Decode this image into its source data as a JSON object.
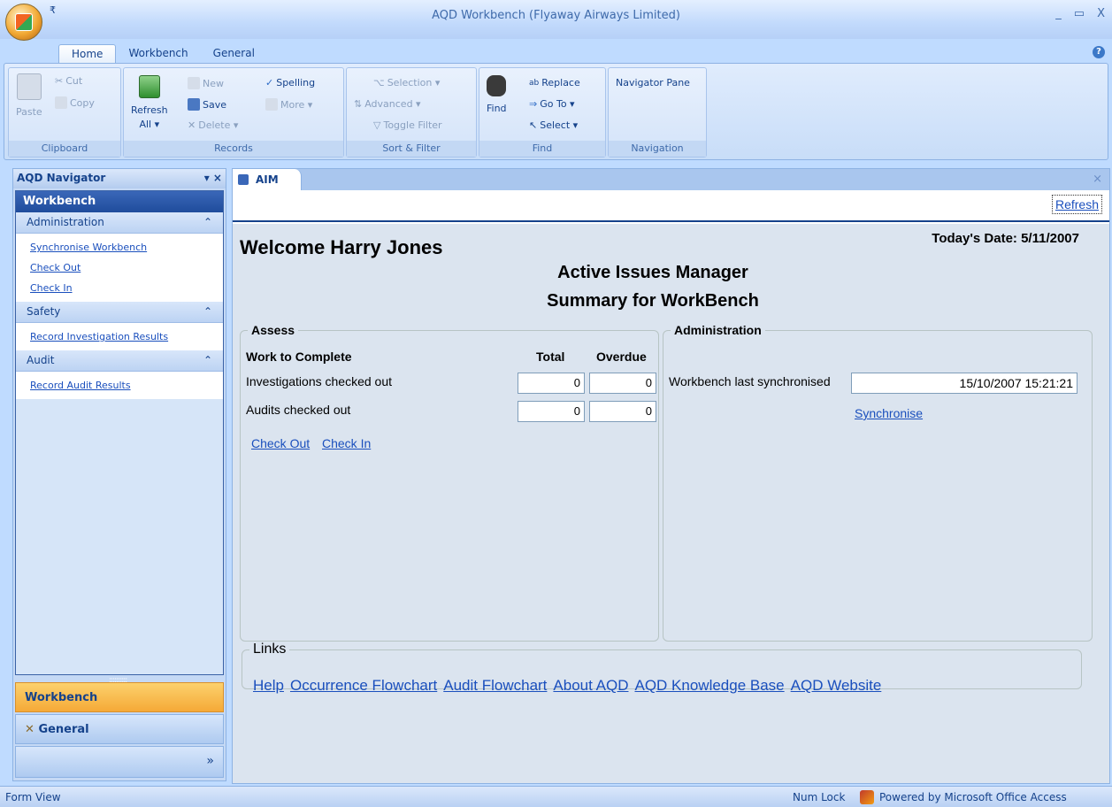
{
  "window": {
    "title": "AQD Workbench (Flyaway Airways Limited)",
    "qat": "₹",
    "minimize": "_",
    "restore": "▭",
    "close": "X"
  },
  "ribbon": {
    "tabs": [
      "Home",
      "Workbench",
      "General"
    ],
    "help": "?",
    "clipboard": {
      "paste": "Paste",
      "cut": "Cut",
      "copy": "Copy",
      "label": "Clipboard"
    },
    "records": {
      "refresh": "Refresh",
      "refresh_sub": "All ▾",
      "new": "New",
      "save": "Save",
      "delete": "Delete ▾",
      "spelling": "Spelling",
      "more": "More ▾",
      "label": "Records"
    },
    "sort_filter": {
      "selection": "Selection ▾",
      "advanced": "Advanced ▾",
      "toggle": "Toggle Filter",
      "label": "Sort & Filter"
    },
    "find": {
      "find": "Find",
      "replace": "Replace",
      "goto": "Go To ▾",
      "select": "Select ▾",
      "label": "Find"
    },
    "navigation": {
      "pane": "Navigator Pane",
      "label": "Navigation"
    }
  },
  "navigator": {
    "title": "AQD Navigator",
    "controls": "▾ ×",
    "workbench_header": "Workbench",
    "sections": [
      {
        "name": "Administration",
        "links": [
          "Synchronise Workbench",
          "Check Out",
          "Check In"
        ]
      },
      {
        "name": "Safety",
        "links": [
          "Record Investigation Results"
        ]
      },
      {
        "name": "Audit",
        "links": [
          "Record Audit Results"
        ]
      }
    ],
    "collapse": "⌃",
    "grip": "::::::::::",
    "bottom_workbench": "Workbench",
    "bottom_general": "General",
    "more": "»"
  },
  "document": {
    "tab": "AIM",
    "close": "×",
    "refresh": "Refresh",
    "welcome": "Welcome Harry Jones",
    "today": "Today's Date: 5/11/2007",
    "heading1": "Active Issues Manager",
    "heading2": "Summary for WorkBench",
    "assess": {
      "legend": "Assess",
      "work_label": "Work to Complete",
      "total_label": "Total",
      "overdue_label": "Overdue",
      "rows": [
        {
          "label": "Investigations checked out",
          "total": "0",
          "overdue": "0"
        },
        {
          "label": "Audits checked out",
          "total": "0",
          "overdue": "0"
        }
      ],
      "check_out": "Check Out",
      "check_in": "Check In"
    },
    "admin": {
      "legend": "Administration",
      "sync_label": "Workbench last synchronised",
      "sync_value": "15/10/2007 15:21:21",
      "synchronise": "Synchronise"
    },
    "links": {
      "legend": "Links",
      "items": [
        "Help",
        "Occurrence Flowchart",
        "Audit Flowchart",
        "About AQD",
        "AQD Knowledge Base",
        "AQD Website"
      ]
    }
  },
  "status": {
    "mode": "Form View",
    "numlock": "Num Lock",
    "powered": "Powered by Microsoft Office Access"
  }
}
